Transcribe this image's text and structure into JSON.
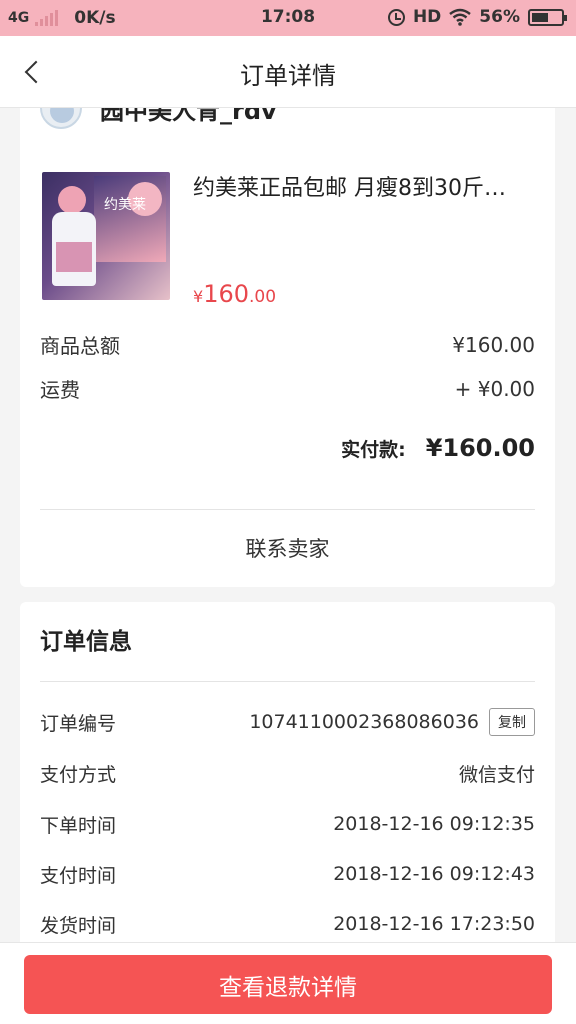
{
  "status_bar": {
    "network": "4G",
    "speed": "0K/s",
    "time": "17:08",
    "hd": "HD",
    "battery_percent": "56%",
    "battery_level": 0.56
  },
  "nav": {
    "title": "订单详情"
  },
  "shop": {
    "name": "园中美人青_rdv"
  },
  "product": {
    "brand_text": "约美莱",
    "title": "约美莱正品包邮 月瘦8到30斤…",
    "price_currency": "¥",
    "price_int": "160",
    "price_dec": ".00"
  },
  "summary": {
    "total_label": "商品总额",
    "total_value": "¥160.00",
    "shipping_label": "运费",
    "shipping_value": "+ ¥0.00",
    "paid_label": "实付款:",
    "paid_value": "¥160.00"
  },
  "contact_seller": "联系卖家",
  "order_info": {
    "title": "订单信息",
    "rows": [
      {
        "label": "订单编号",
        "value": "1074110002368086036"
      },
      {
        "label": "支付方式",
        "value": "微信支付"
      },
      {
        "label": "下单时间",
        "value": "2018-12-16 09:12:35"
      },
      {
        "label": "支付时间",
        "value": "2018-12-16 09:12:43"
      },
      {
        "label": "发货时间",
        "value": "2018-12-16 17:23:50"
      }
    ],
    "copy_label": "复制"
  },
  "refund_button": "查看退款详情",
  "colors": {
    "status_bar": "#f6b3bd",
    "price_red": "#e8474c",
    "button_red": "#f55454"
  }
}
